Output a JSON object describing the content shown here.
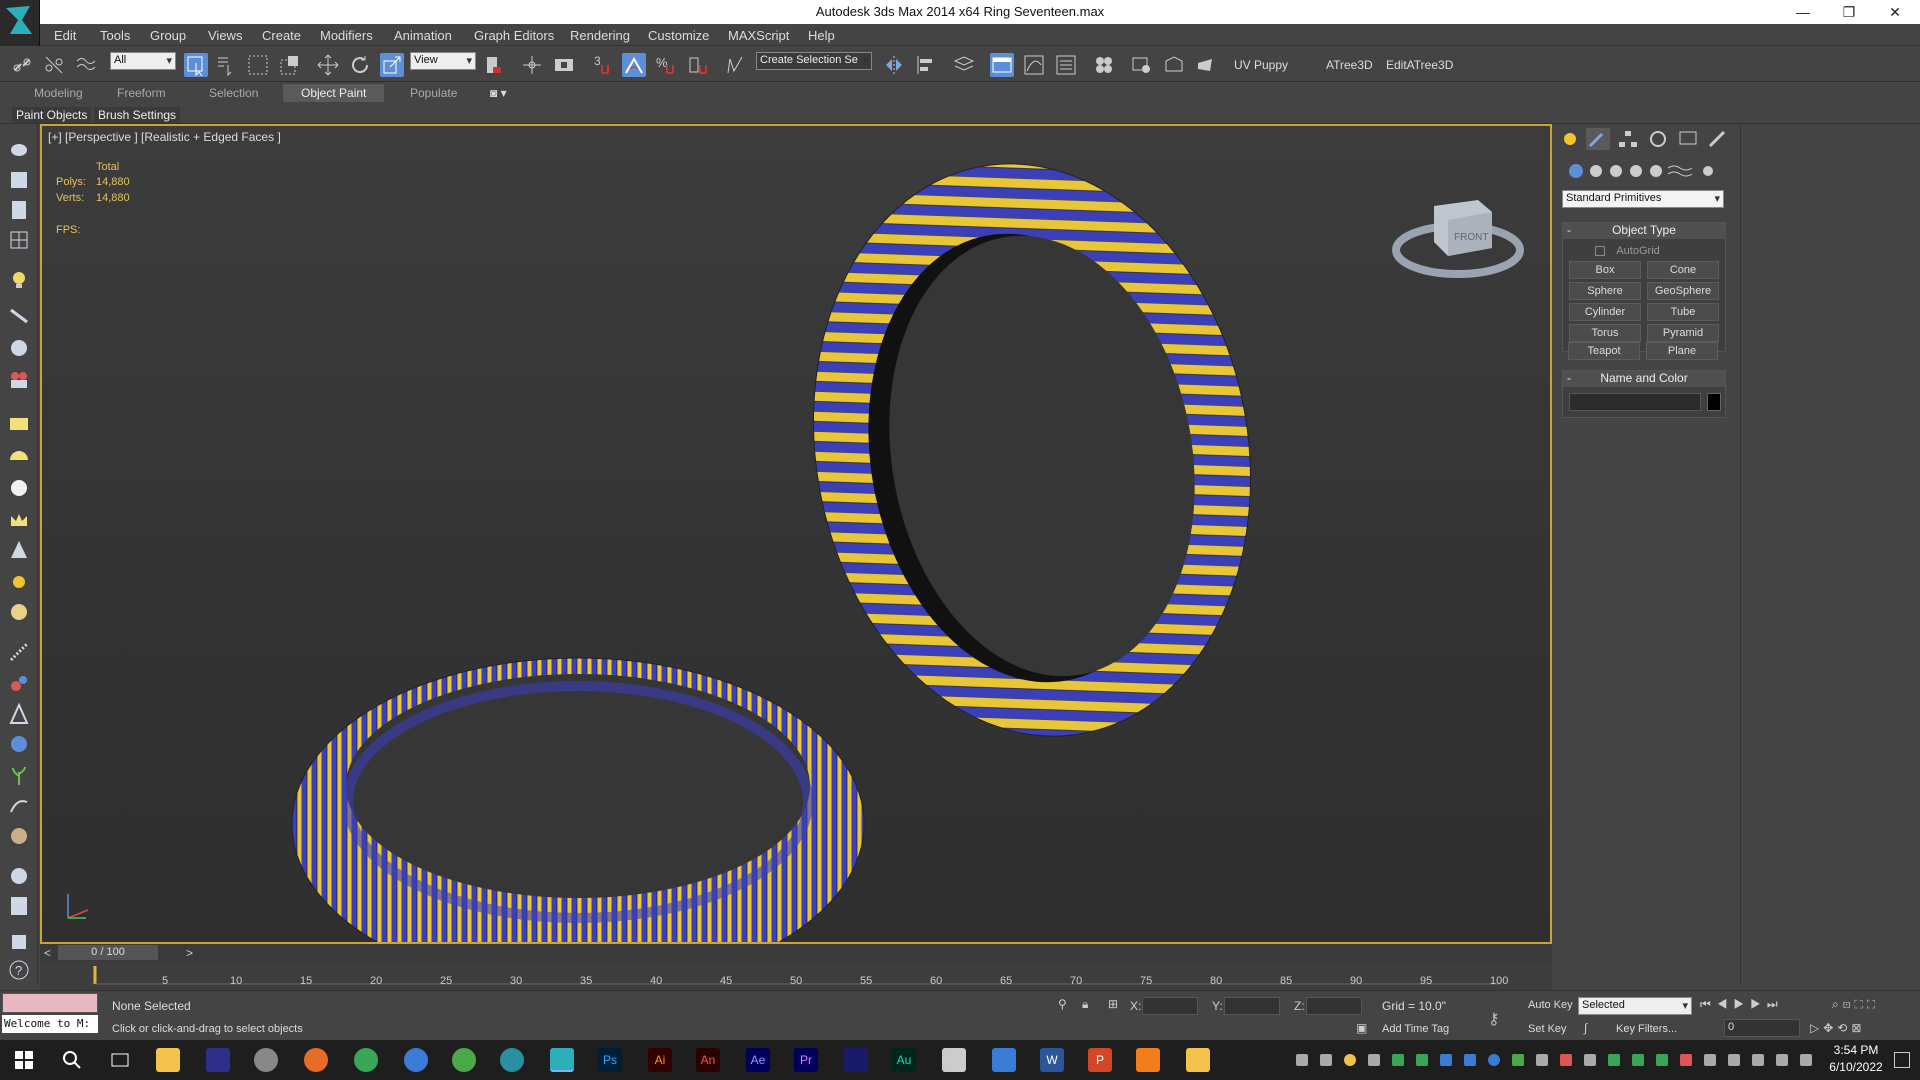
{
  "window": {
    "title": "Autodesk 3ds Max  2014 x64     Ring Seventeen.max",
    "minimize": "—",
    "restore": "❐",
    "close": "✕"
  },
  "menu": [
    "Edit",
    "Tools",
    "Group",
    "Views",
    "Create",
    "Modifiers",
    "Animation",
    "Graph Editors",
    "Rendering",
    "Customize",
    "MAXScript",
    "Help"
  ],
  "toolbar": {
    "filter": "All",
    "ref_coord": "View",
    "selection_set": "Create Selection Se",
    "uvpuppy": "UV Puppy",
    "atree": "ATree3D",
    "editatree": "EditATree3D",
    "snap": "3",
    "percent": "%"
  },
  "ribbon": {
    "tabs": [
      "Modeling",
      "Freeform",
      "Selection",
      "Object Paint",
      "Populate"
    ],
    "active": "Object Paint",
    "sub": [
      "Paint Objects",
      "Brush Settings"
    ]
  },
  "viewport": {
    "label": "[+] [Perspective ] [Realistic + Edged Faces ]",
    "total": "Total",
    "polys_label": "Polys:",
    "polys": "14,880",
    "verts_label": "Verts:",
    "verts": "14,880",
    "fps": "FPS:",
    "viewcube": "FRONT"
  },
  "command_panel": {
    "category": "Standard Primitives",
    "object_type": "Object Type",
    "autogrid": "AutoGrid",
    "buttons": [
      "Box",
      "Cone",
      "Sphere",
      "GeoSphere",
      "Cylinder",
      "Tube",
      "Torus",
      "Pyramid",
      "Teapot",
      "Plane"
    ],
    "name_color": "Name and Color"
  },
  "timeline": {
    "position": "0 / 100",
    "ticks": [
      "5",
      "10",
      "15",
      "20",
      "25",
      "30",
      "35",
      "40",
      "45",
      "50",
      "55",
      "60",
      "65",
      "70",
      "75",
      "80",
      "85",
      "90",
      "95",
      "100"
    ]
  },
  "status": {
    "maxscript": "Welcome to M:",
    "selection": "None Selected",
    "prompt": "Click or click-and-drag to select objects",
    "x": "X:",
    "y": "Y:",
    "z": "Z:",
    "grid": "Grid = 10.0\"",
    "add_time_tag": "Add Time Tag",
    "auto_key": "Auto Key",
    "set_key": "Set Key",
    "key_mode": "Selected",
    "key_filters": "Key Filters...",
    "frame": "0"
  },
  "taskbar": {
    "time": "3:54 PM",
    "date": "6/10/2022",
    "apps": [
      "Ps",
      "Ai",
      "An",
      "Ae",
      "Pr",
      "Au",
      "W",
      "P"
    ]
  },
  "colors": {
    "accent": "#5d8fd8",
    "viewport_border": "#c9a33c",
    "ring_yellow": "#e8c63a",
    "ring_blue": "#3b3fb8"
  }
}
